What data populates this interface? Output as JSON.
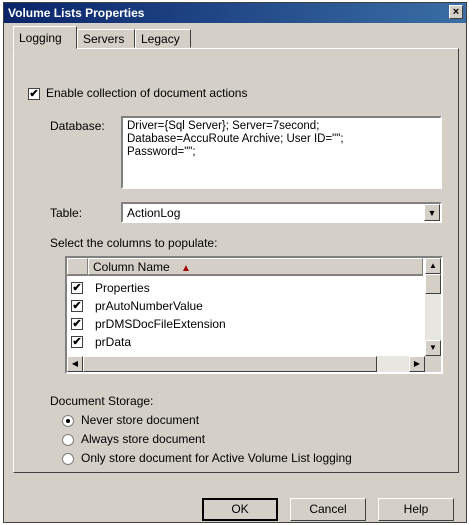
{
  "window": {
    "title": "Volume Lists Properties",
    "close_label": "×"
  },
  "tabs": [
    {
      "label": "Logging",
      "active": true
    },
    {
      "label": "Servers",
      "active": false
    },
    {
      "label": "Legacy",
      "active": false
    }
  ],
  "logging": {
    "enable_label": "Enable collection of document actions",
    "enable_checked": true,
    "database_label": "Database:",
    "database_lines": [
      "Driver={Sql Server}; Server=7second;",
      "Database=AccuRoute Archive; User ID=\"\";",
      "Password=\"\";"
    ],
    "table_label": "Table:",
    "table_value": "ActionLog",
    "columns_label": "Select the columns to populate:",
    "columns_header": "Column Name",
    "columns": [
      {
        "name": "Properties",
        "checked": true
      },
      {
        "name": "prAutoNumberValue",
        "checked": true
      },
      {
        "name": "prDMSDocFileExtension",
        "checked": true
      },
      {
        "name": "prData",
        "checked": true
      }
    ],
    "storage_label": "Document Storage:",
    "storage_options": [
      {
        "label": "Never store document",
        "selected": true
      },
      {
        "label": "Always store document",
        "selected": false
      },
      {
        "label": "Only store document for Active Volume List logging",
        "selected": false
      }
    ]
  },
  "buttons": {
    "ok": "OK",
    "cancel": "Cancel",
    "help": "Help"
  },
  "icons": {
    "check": "✔",
    "sort_up": "▲",
    "arrow_down": "▼",
    "arrow_up": "▲",
    "arrow_left": "◀",
    "arrow_right": "▶"
  }
}
